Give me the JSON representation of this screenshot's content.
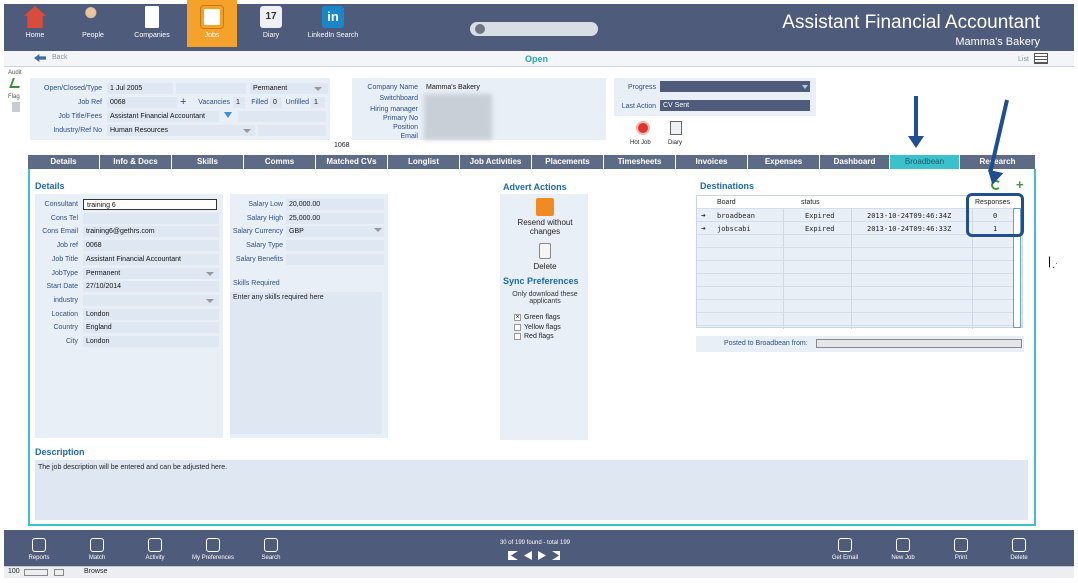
{
  "nav": {
    "items": [
      {
        "label": "Home",
        "icon": "home-icon"
      },
      {
        "label": "People",
        "icon": "people-icon"
      },
      {
        "label": "Companies",
        "icon": "companies-icon"
      },
      {
        "label": "Jobs",
        "icon": "jobs-icon"
      },
      {
        "label": "Diary",
        "icon": "diary-icon"
      },
      {
        "label": "LinkedIn Search",
        "icon": "linkedin-icon"
      }
    ],
    "diary_day": "17",
    "linkedin_glyph": "in"
  },
  "header": {
    "title": "Assistant Financial Accountant",
    "subtitle": "Mamma's Bakery",
    "back": "Back",
    "status": "Open",
    "list": "List"
  },
  "audit": {
    "audit": "Audit",
    "flag": "Flag"
  },
  "job": {
    "open_closed_type_label": "Open/Closed/Type",
    "open_date": "1 Jul 2005",
    "type": "Permanent",
    "job_ref_label": "Job Ref",
    "job_ref": "0068",
    "vacancies_label": "Vacancies",
    "vacancies": "1",
    "filled_label": "Filled",
    "filled": "0",
    "unfilled_label": "Unfilled",
    "unfilled": "1",
    "title_fees_label": "Job Title/Fees",
    "title": "Assistant Financial Accountant",
    "industry_label": "Industry/Ref No",
    "industry": "Human Resources"
  },
  "company": {
    "name_label": "Company Name",
    "name": "Mamma's Bakery",
    "switchboard_label": "Switchboard",
    "hiring_manager_label": "Hiring manager",
    "primary_no_label": "Primary No",
    "position_label": "Position",
    "email_label": "Email",
    "ref": "1068"
  },
  "progress": {
    "progress_label": "Progress",
    "last_action_label": "Last Action",
    "last_action": "CV Sent",
    "hot_job": "Hot Job",
    "diary": "Diary"
  },
  "tabs": [
    "Details",
    "Info & Docs",
    "Skills",
    "Comms",
    "Matched CVs",
    "Longlist",
    "Job Activities",
    "Placements",
    "Timesheets",
    "Invoices",
    "Expenses",
    "Dashboard",
    "Broadbean",
    "Research"
  ],
  "details": {
    "heading": "Details",
    "fields": [
      {
        "label": "Consultant",
        "value": "training 6"
      },
      {
        "label": "Cons Tel",
        "value": ""
      },
      {
        "label": "Cons Email",
        "value": "training6@gethrs.com"
      },
      {
        "label": "Job ref",
        "value": "0068"
      },
      {
        "label": "Job Title",
        "value": "Assistant Financial Accountant"
      },
      {
        "label": "JobType",
        "value": "Permanent"
      },
      {
        "label": "Start Date",
        "value": "27/10/2014"
      },
      {
        "label": "industry",
        "value": ""
      },
      {
        "label": "Location",
        "value": "London"
      },
      {
        "label": "Country",
        "value": "England"
      },
      {
        "label": "City",
        "value": "London"
      }
    ]
  },
  "salary": {
    "fields": [
      {
        "label": "Salary Low",
        "value": "20,000.00"
      },
      {
        "label": "Salary High",
        "value": "25,000.00"
      },
      {
        "label": "Salary Currency",
        "value": "GBP"
      },
      {
        "label": "Salary Type",
        "value": ""
      },
      {
        "label": "Salary Benefits",
        "value": ""
      }
    ],
    "skills_label": "Skills Required",
    "skills_placeholder": "Enter any skills required here"
  },
  "advert": {
    "heading": "Advert Actions",
    "resend": "Resend without changes",
    "delete": "Delete",
    "sync_heading": "Sync Preferences",
    "sync_desc": "Only download these applicants",
    "flags": [
      {
        "label": "Green flags",
        "checked": true
      },
      {
        "label": "Yellow flags",
        "checked": false
      },
      {
        "label": "Red flags",
        "checked": false
      }
    ]
  },
  "destinations": {
    "heading": "Destinations",
    "columns": [
      "Board",
      "status",
      "",
      "Responses"
    ],
    "rows": [
      {
        "board": "broadbean",
        "status": "Expired",
        "date": "2013-10-24T09:46:34Z",
        "responses": "0"
      },
      {
        "board": "jobscabi",
        "status": "Expired",
        "date": "2013-10-24T09:46:33Z",
        "responses": "1"
      }
    ],
    "posted_label": "Posted to Broadbean from:"
  },
  "description": {
    "heading": "Description",
    "text": "The job description will be entered and can be adjusted here."
  },
  "toolbar": {
    "left": [
      {
        "label": "Reports",
        "icon": "reports-icon"
      },
      {
        "label": "Match",
        "icon": "match-icon"
      },
      {
        "label": "Activity",
        "icon": "activity-icon"
      },
      {
        "label": "My Preferences",
        "icon": "preferences-icon"
      },
      {
        "label": "Search",
        "icon": "search-icon"
      }
    ],
    "record_count": "30 of 199 found - total 199",
    "right": [
      {
        "label": "Get Email",
        "icon": "email-icon"
      },
      {
        "label": "New Job",
        "icon": "new-job-icon"
      },
      {
        "label": "Print",
        "icon": "print-icon"
      },
      {
        "label": "Delete",
        "icon": "trash-icon"
      }
    ]
  },
  "statusbar": {
    "zoom": "100",
    "mode": "Browse"
  },
  "colors": {
    "nav": "#4f5b7a",
    "accent": "#3bc1c9",
    "active_nav": "#f5a22a",
    "field": "#dfe8f2"
  }
}
